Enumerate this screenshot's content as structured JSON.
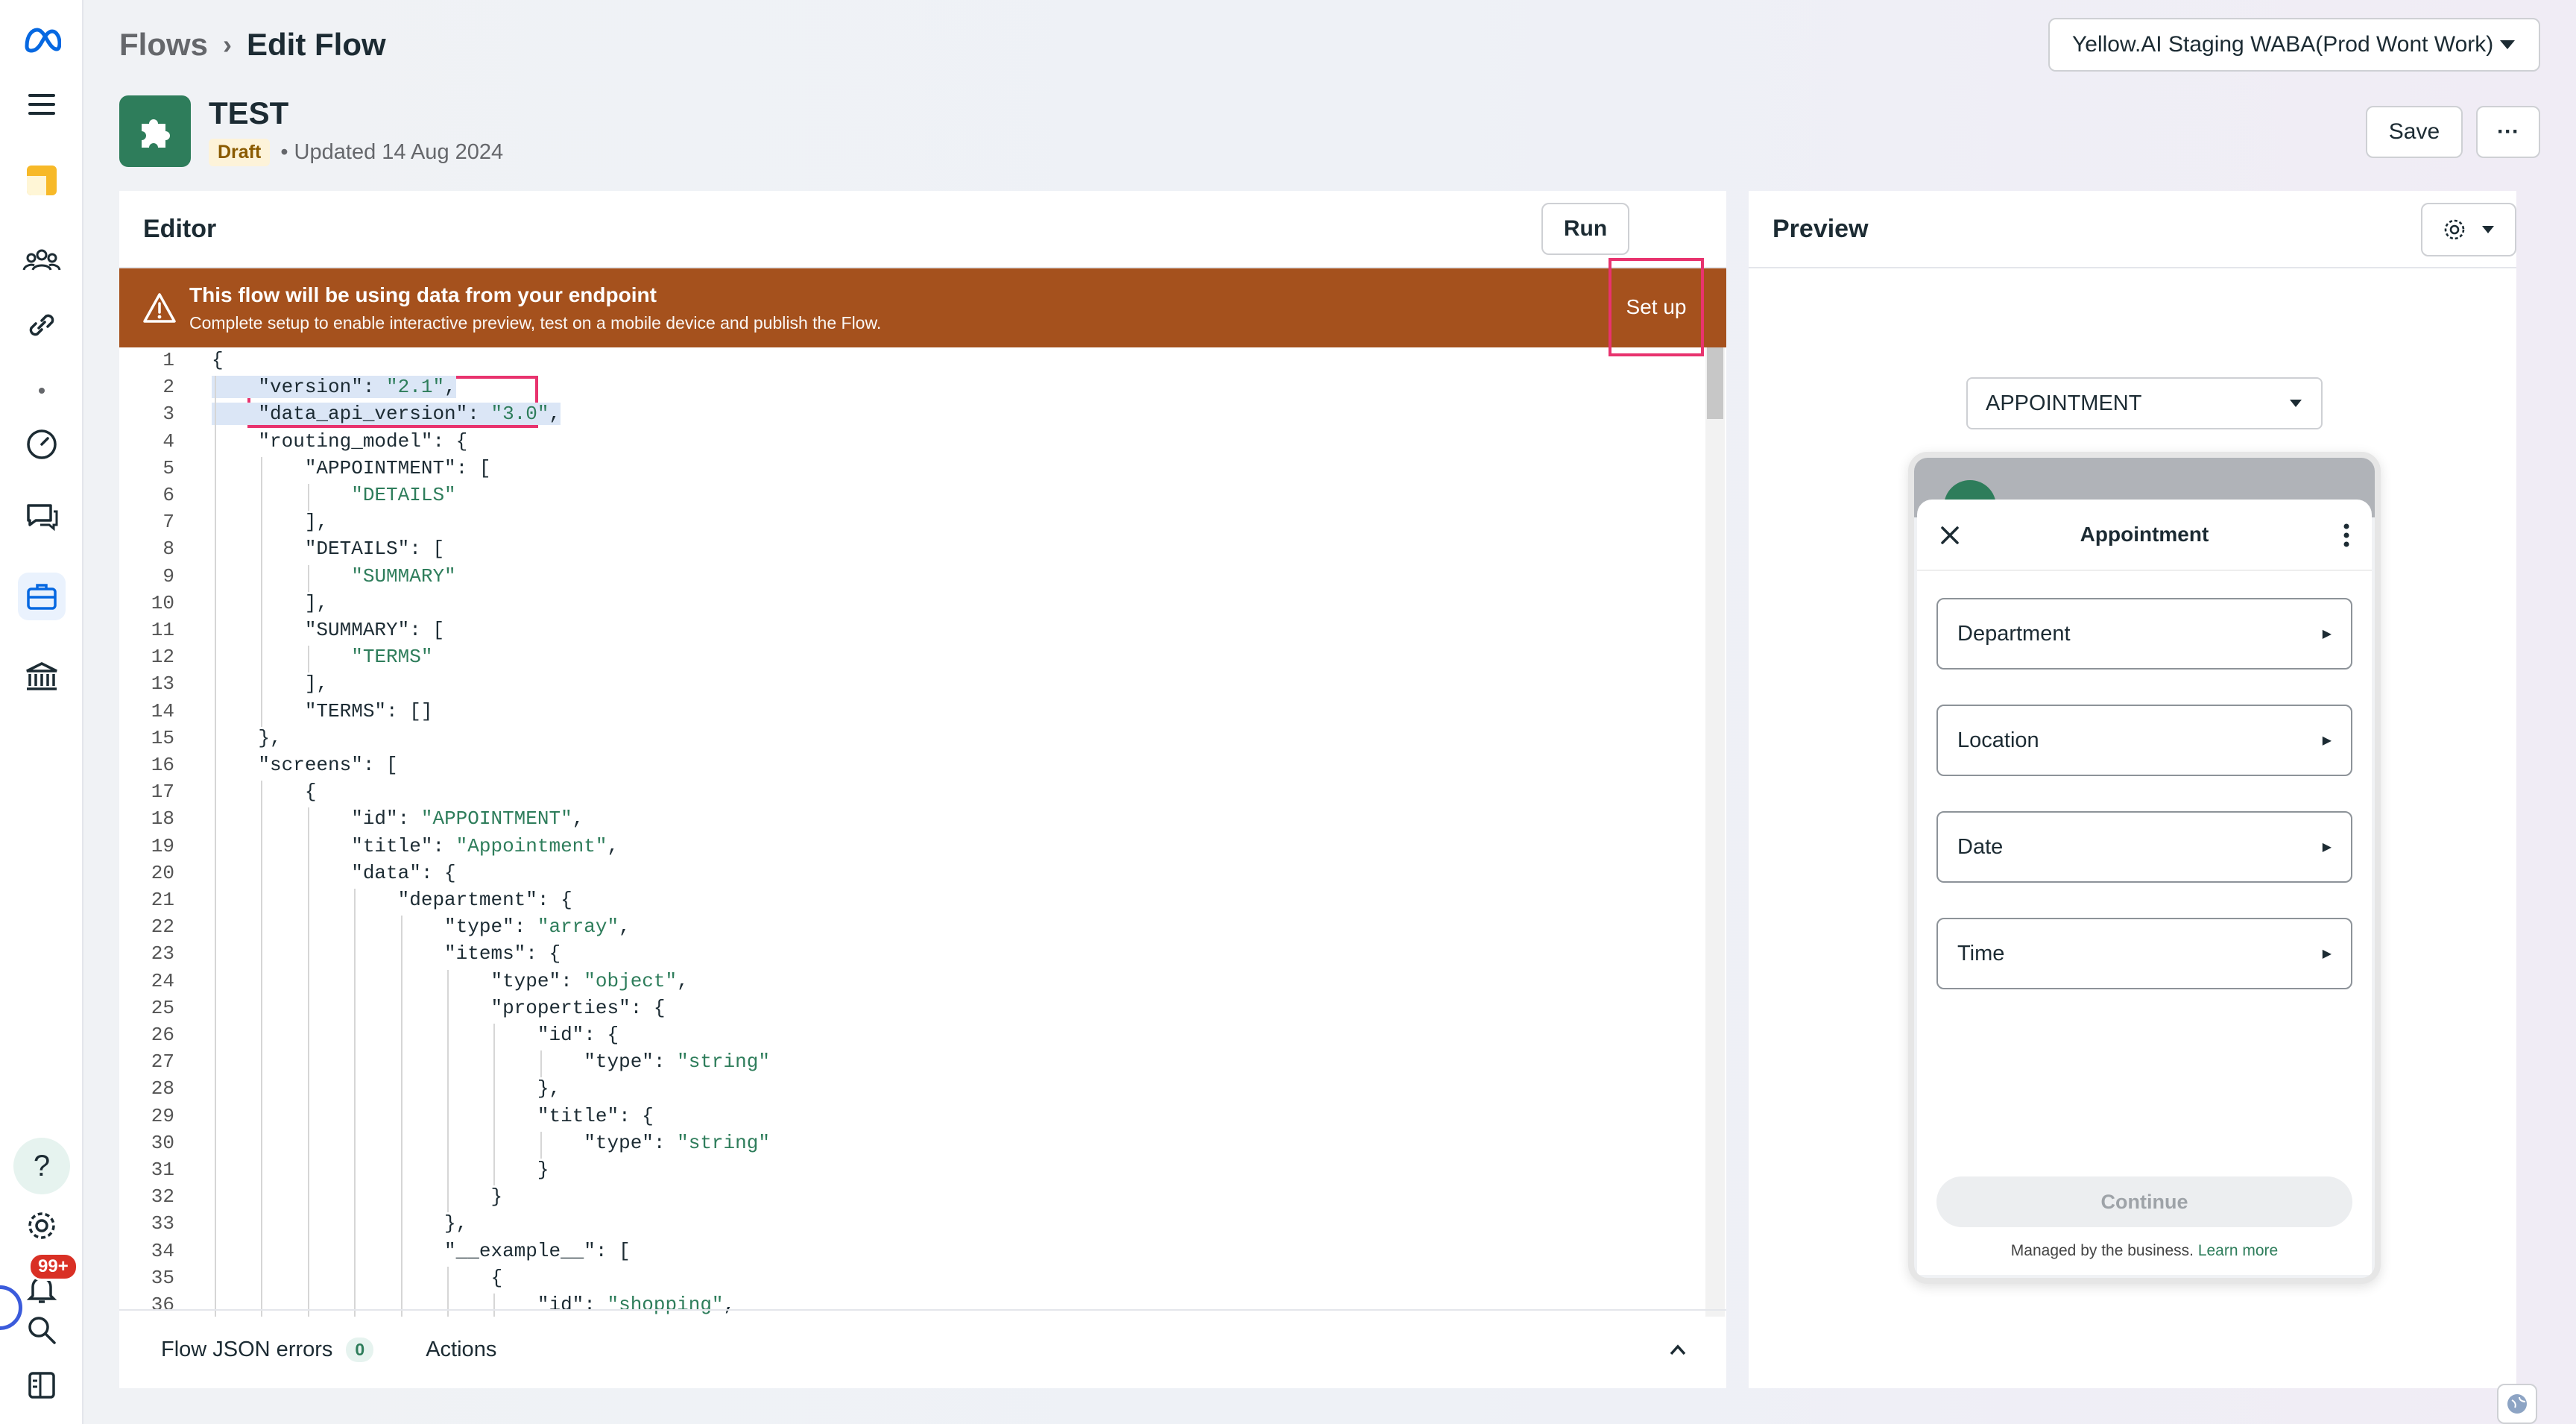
{
  "breadcrumb": {
    "flows": "Flows",
    "current": "Edit Flow"
  },
  "account": {
    "name": "Yellow.AI Staging WABA(Prod Wont Work)"
  },
  "flow": {
    "title": "TEST",
    "status": "Draft",
    "updated": "• Updated 14 Aug 2024"
  },
  "toolbar": {
    "save": "Save",
    "more": "···"
  },
  "editor": {
    "title": "Editor",
    "run": "Run",
    "banner_title": "This flow will be using data from your endpoint",
    "banner_text": "Complete setup to enable interactive preview, test on a mobile device and publish the Flow.",
    "setup": "Set up",
    "footer_errors": "Flow JSON errors",
    "footer_error_count": "0",
    "footer_actions": "Actions",
    "code_lines": [
      "{",
      "    \"version\": \"2.1\",",
      "    \"data_api_version\": \"3.0\",",
      "    \"routing_model\": {",
      "        \"APPOINTMENT\": [",
      "            \"DETAILS\"",
      "        ],",
      "        \"DETAILS\": [",
      "            \"SUMMARY\"",
      "        ],",
      "        \"SUMMARY\": [",
      "            \"TERMS\"",
      "        ],",
      "        \"TERMS\": []",
      "    },",
      "    \"screens\": [",
      "        {",
      "            \"id\": \"APPOINTMENT\",",
      "            \"title\": \"Appointment\",",
      "            \"data\": {",
      "                \"department\": {",
      "                    \"type\": \"array\",",
      "                    \"items\": {",
      "                        \"type\": \"object\",",
      "                        \"properties\": {",
      "                            \"id\": {",
      "                                \"type\": \"string\"",
      "                            },",
      "                            \"title\": {",
      "                                \"type\": \"string\"",
      "                            }",
      "                        }",
      "                    },",
      "                    \"__example__\": [",
      "                        {",
      "                            \"id\": \"shopping\","
    ]
  },
  "preview": {
    "title": "Preview",
    "screen_select": "APPOINTMENT",
    "sheet_title": "Appointment",
    "fields": [
      "Department",
      "Location",
      "Date",
      "Time"
    ],
    "continue": "Continue",
    "managed": "Managed by the business.",
    "learn_more": "Learn more"
  },
  "sidebar": {
    "notification_badge": "99+",
    "help": "?"
  },
  "colors": {
    "banner": "#a5511d",
    "accent": "#2e7d5b",
    "highlight": "#e8336e"
  }
}
